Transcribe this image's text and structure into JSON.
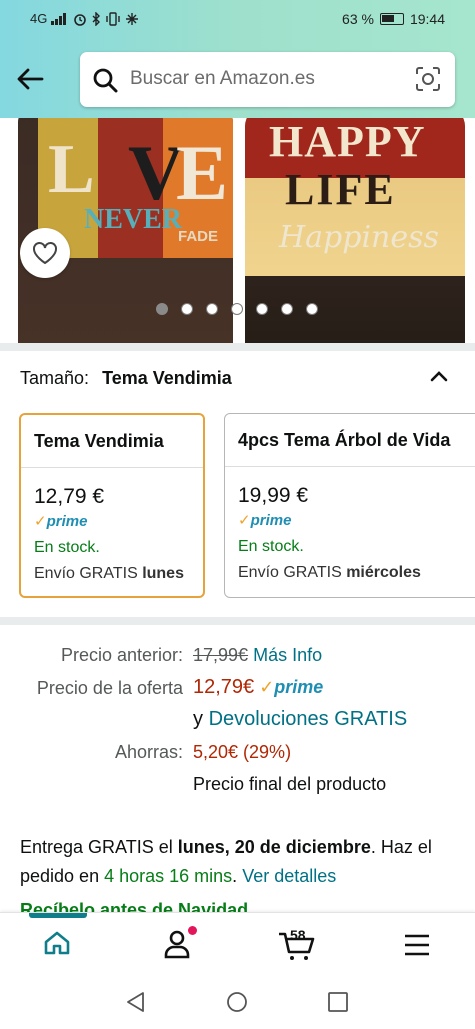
{
  "status_bar": {
    "network": "4G",
    "battery_percent": "63 %",
    "time": "19:44"
  },
  "header": {
    "search_placeholder": "Buscar en Amazon.es"
  },
  "hero": {
    "image_texts": {
      "love_l": "L",
      "love_v": "V",
      "love_e": "E",
      "never": "NEVER",
      "fade": "FADE",
      "happy": "HAPPY",
      "life": "LIFE",
      "happiness": "Happiness"
    },
    "carousel_dots": 7,
    "active_dot": 0
  },
  "size_selector": {
    "label": "Tamaño:",
    "selected": "Tema Vendimia",
    "options": [
      {
        "title": "Tema Vendimia",
        "price": "12,79 €",
        "prime": "prime",
        "stock": "En stock.",
        "shipping_prefix": "Envío GRATIS",
        "shipping_day": "lunes"
      },
      {
        "title": "4pcs Tema Árbol de Vida",
        "price": "19,99 €",
        "prime": "prime",
        "stock": "En stock.",
        "shipping_prefix": "Envío GRATIS",
        "shipping_day": "miércoles"
      }
    ]
  },
  "pricing": {
    "previous_label": "Precio anterior:",
    "previous_price": "17,99€",
    "more_info": "Más Info",
    "offer_label": "Precio de la oferta",
    "offer_price": "12,79€",
    "prime": "prime",
    "returns_prefix": "y",
    "returns_link": "Devoluciones GRATIS",
    "savings_label": "Ahorras:",
    "savings_value": "5,20€ (29%)",
    "final_note": "Precio final del producto"
  },
  "delivery": {
    "prefix": "Entrega GRATIS el",
    "date": "lunes, 20 de diciembre",
    "middle": ". Haz el pedido en",
    "countdown": "4 horas 16 mins",
    "sep": ".",
    "details_link": "Ver detalles",
    "teaser": "Recíbelo antes de Navidad"
  },
  "bottom_nav": {
    "cart_count": "58",
    "items": [
      "home",
      "account",
      "cart",
      "menu"
    ]
  },
  "colors": {
    "header_gradient_start": "#84d8e0",
    "header_gradient_end": "#a6e6cf",
    "link": "#007185",
    "price_red": "#b12704",
    "in_stock_green": "#067d17",
    "prime_blue": "#1f8eb3",
    "selected_border": "#e7a33a"
  }
}
